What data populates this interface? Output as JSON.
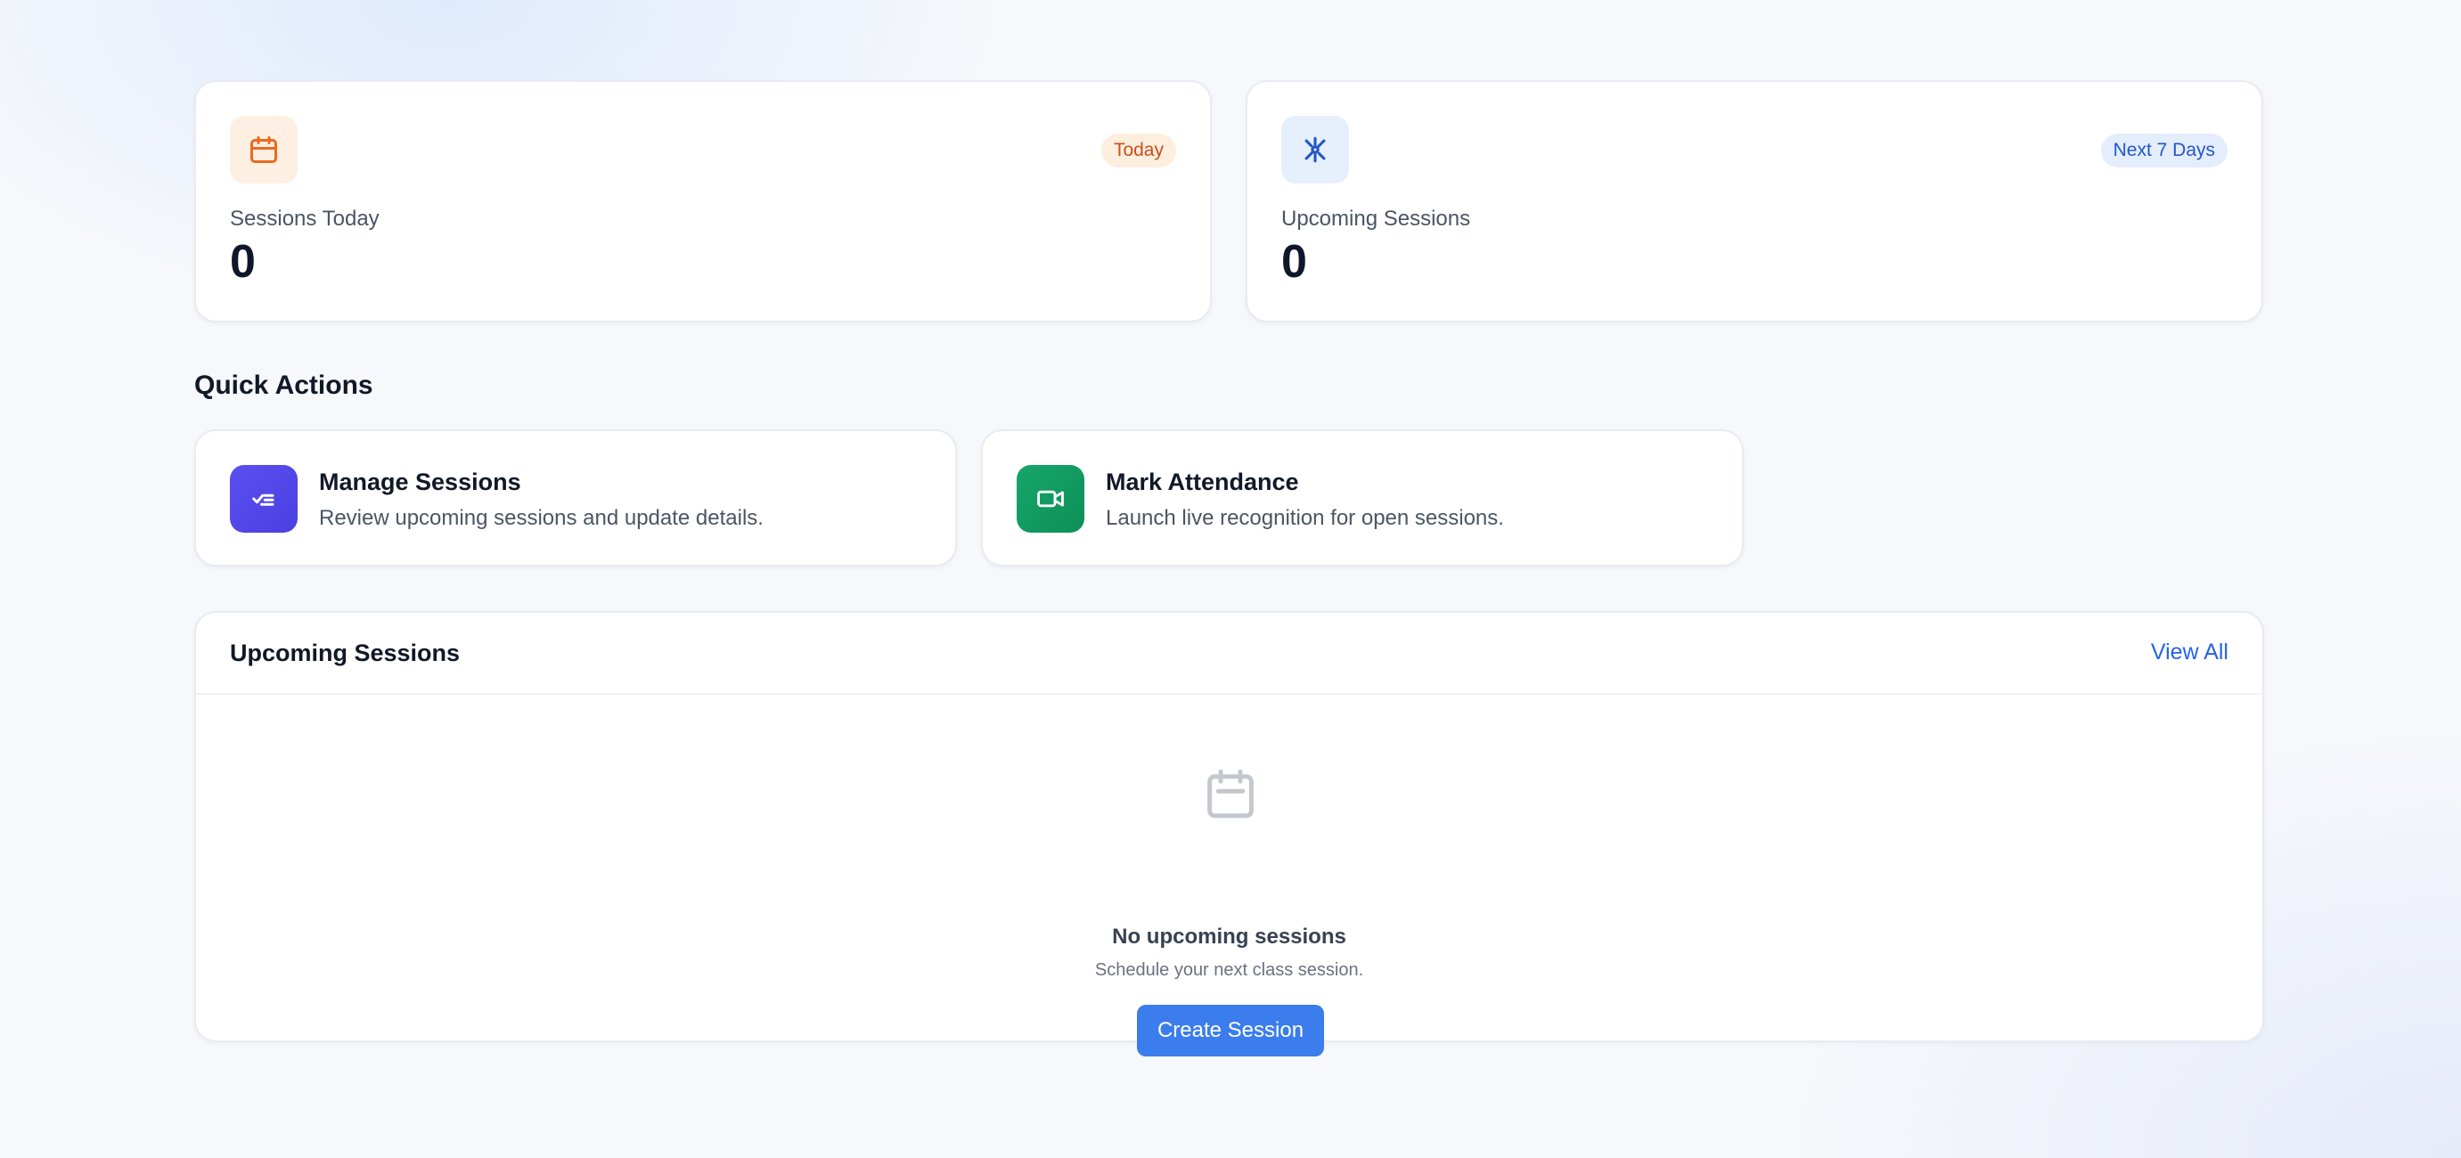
{
  "stats": {
    "today": {
      "icon": "calendar-icon",
      "badge": "Today",
      "label": "Sessions Today",
      "value": "0",
      "accent": "#ea6a1f"
    },
    "upcoming": {
      "icon": "sparkle-icon",
      "badge": "Next 7 Days",
      "label": "Upcoming Sessions",
      "value": "0",
      "accent": "#2457c7"
    }
  },
  "quick_actions": {
    "title": "Quick Actions",
    "items": [
      {
        "icon": "checklist-icon",
        "title": "Manage Sessions",
        "description": "Review upcoming sessions and update details.",
        "color": "#4f46e5"
      },
      {
        "icon": "video-camera-icon",
        "title": "Mark Attendance",
        "description": "Launch live recognition for open sessions.",
        "color": "#0f9960"
      }
    ]
  },
  "upcoming_panel": {
    "title": "Upcoming Sessions",
    "view_all": "View All",
    "empty_title": "No upcoming sessions",
    "empty_subtitle": "Schedule your next class session.",
    "create_button": "Create Session",
    "button_color": "#3b7ded"
  }
}
